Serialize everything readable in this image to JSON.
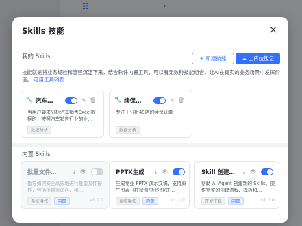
{
  "background": {
    "nav_icon": "sidebar-menu-icon",
    "nav_chevron": "›"
  },
  "modal": {
    "title": "Skills 技能",
    "close_icon": "×",
    "my_skills_label": "我的 Skills",
    "new_skill_button": "+ 新建技能",
    "upload_button": "上传技能包",
    "intro_text": "技能就是将业务经验和流程沉淀下来，结合软件内置工具，可以有无数种技能组合，让AI在真实的业务场景中发挥价值。",
    "intro_link": "可用工具列表",
    "builtin_label": "内置 Skills"
  },
  "my_skills": [
    {
      "title": "汽车…",
      "desc": "当用户要求分析汽车销售Excel数据时，按照汽车销售行业的业…",
      "tag": "数据分析",
      "enabled": true
    },
    {
      "title": "续保…",
      "desc": "专注于分析4S店的续保订单",
      "tag": "数据分析",
      "enabled": true
    }
  ],
  "builtin_skills": [
    {
      "title": "批量文件…",
      "desc": "指导如何安全高效地进行批量文件操作，包括批量重命名、格…",
      "tags": [
        "系统操作",
        "内置"
      ],
      "version": "v1.0.0",
      "enabled": false
    },
    {
      "title": "PPTX生成",
      "desc": "生成专业 PPTX 演示文稿，支持原生图表（柱状图/折线图/饼…",
      "tags": [
        "系统操作",
        "内置"
      ],
      "version": "v1.1.0",
      "enabled": true
    },
    {
      "title": "Skill 创建…",
      "desc": "帮助 AI Agent 创建新的 Skills。提供完整的创建流程、模板和…",
      "tags": [
        "开发工具",
        "内置"
      ],
      "version": "v1.0.0",
      "enabled": true
    }
  ],
  "colors": {
    "accent": "#3370ff",
    "toggle_off": "#d0d3d8"
  }
}
